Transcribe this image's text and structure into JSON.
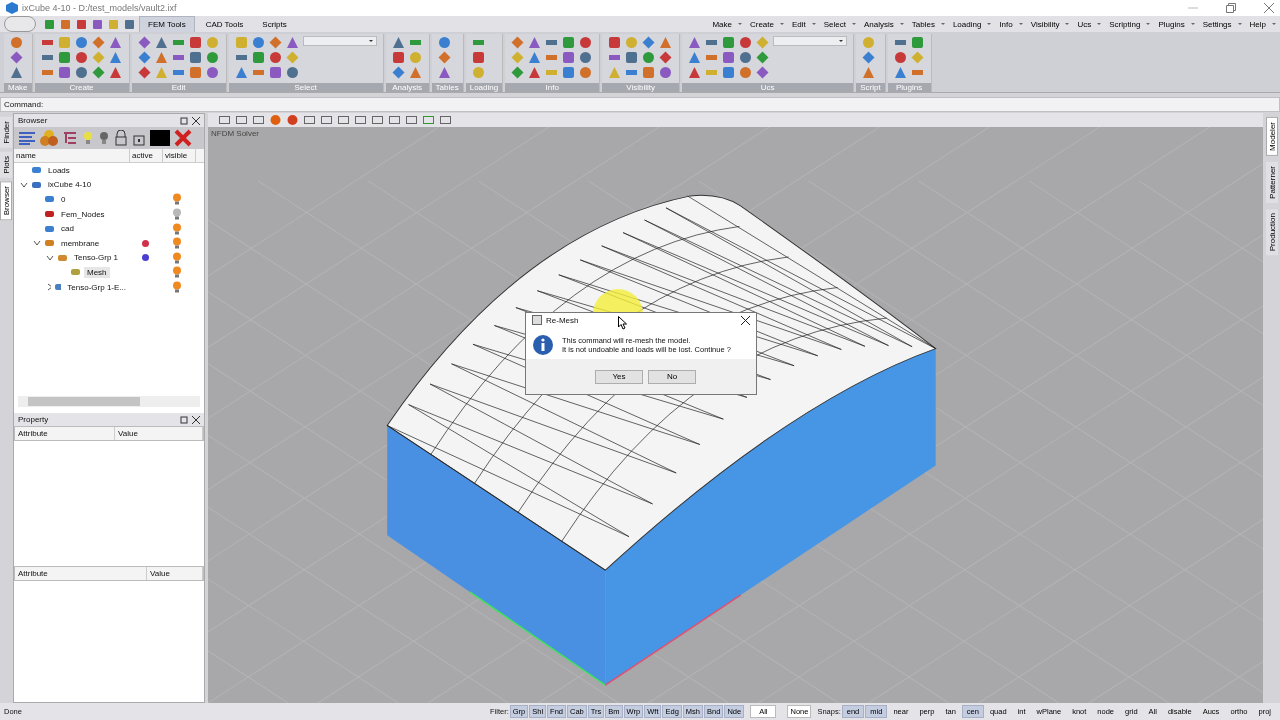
{
  "window": {
    "title": "ixCube 4-10 - D:/test_models/vault2.ixf"
  },
  "ribbon_tabs": [
    {
      "label": "FEM Tools",
      "selected": true
    },
    {
      "label": "CAD Tools",
      "selected": false
    },
    {
      "label": "Scripts",
      "selected": false
    }
  ],
  "menus": [
    "Make",
    "Create",
    "Edit",
    "Select",
    "Analysis",
    "Tables",
    "Loading",
    "Info",
    "Visibility",
    "Ucs",
    "Scripting",
    "Plugins",
    "Settings",
    "Help"
  ],
  "ribbon_groups": [
    "Make",
    "Create",
    "Edit",
    "Select",
    "Analysis",
    "Tables",
    "Loading",
    "Info",
    "Visibility",
    "Ucs",
    "Script",
    "Plugins"
  ],
  "command_bar": {
    "label": "Command:"
  },
  "side_tabs": [
    {
      "label": "Finder",
      "selected": false
    },
    {
      "label": "Plots",
      "selected": false
    },
    {
      "label": "Browser",
      "selected": true
    }
  ],
  "browser": {
    "title": "Browser",
    "columns": [
      "name",
      "active",
      "visible"
    ],
    "tree": [
      {
        "label": "Loads",
        "kind": "loads",
        "selected": false
      },
      {
        "label": "ixCube 4-10",
        "kind": "model",
        "selected": false,
        "expanded": true,
        "children": [
          {
            "label": "0",
            "kind": "layer",
            "selected": false,
            "visible": true
          },
          {
            "label": "Fem_Nodes",
            "kind": "nodes",
            "selected": false,
            "visible": false
          },
          {
            "label": "cad",
            "kind": "layer",
            "selected": false,
            "visible": true
          },
          {
            "label": "membrane",
            "kind": "group",
            "selected": false,
            "visible": true,
            "color": "#d0304a",
            "expanded": true,
            "children": [
              {
                "label": "Tenso-Grp 1",
                "kind": "tenso",
                "selected": false,
                "visible": true,
                "color": "#4a3fd0",
                "expanded": true,
                "children": [
                  {
                    "label": "Mesh",
                    "kind": "mesh",
                    "selected": true,
                    "visible": true
                  }
                ]
              },
              {
                "label": "Tenso-Grp 1-E...",
                "kind": "edge",
                "selected": false,
                "visible": true,
                "expanded": false
              }
            ]
          }
        ]
      }
    ]
  },
  "property": {
    "title": "Property",
    "columns": [
      "Attribute",
      "Value"
    ],
    "columns_lower": [
      "Attribute",
      "Value"
    ]
  },
  "viewport": {
    "label": "NFDM Solver"
  },
  "right_tabs": [
    {
      "label": "Modeler",
      "selected": true
    },
    {
      "label": "Patterner",
      "selected": false
    },
    {
      "label": "Production",
      "selected": false
    }
  ],
  "dialog": {
    "title": "Re-Mesh",
    "lines": [
      "This command will re-mesh the model.",
      "It is not undoable and loads will be lost. Continue ?"
    ],
    "buttons": [
      "Yes",
      "No"
    ]
  },
  "status_bar": {
    "message": "Done",
    "filter_label": "Filter:",
    "filters": [
      {
        "label": "Grp",
        "selected": true
      },
      {
        "label": "Shl",
        "selected": true
      },
      {
        "label": "Fnd",
        "selected": true
      },
      {
        "label": "Cab",
        "selected": true
      },
      {
        "label": "Trs",
        "selected": true
      },
      {
        "label": "Bm",
        "selected": true
      },
      {
        "label": "Wrp",
        "selected": true
      },
      {
        "label": "Wft",
        "selected": true
      },
      {
        "label": "Edg",
        "selected": true
      },
      {
        "label": "Msh",
        "selected": true
      },
      {
        "label": "Bnd",
        "selected": true
      },
      {
        "label": "Nde",
        "selected": true
      }
    ],
    "filter_all": "All",
    "snaps_none": "None",
    "snaps_label": "Snaps:",
    "snaps": [
      {
        "label": "end",
        "selected": true
      },
      {
        "label": "mid",
        "selected": true
      },
      {
        "label": "near",
        "selected": false
      },
      {
        "label": "perp",
        "selected": false
      },
      {
        "label": "tan",
        "selected": false
      },
      {
        "label": "cen",
        "selected": true
      },
      {
        "label": "quad",
        "selected": false
      },
      {
        "label": "int",
        "selected": false
      },
      {
        "label": "wPlane",
        "selected": false
      },
      {
        "label": "knot",
        "selected": false
      },
      {
        "label": "node",
        "selected": false
      },
      {
        "label": "grid",
        "selected": false
      },
      {
        "label": "All",
        "selected": false
      },
      {
        "label": "disable",
        "selected": false
      },
      {
        "label": "Aucs",
        "selected": false
      },
      {
        "label": "ortho",
        "selected": false
      },
      {
        "label": "proj",
        "selected": false
      }
    ]
  }
}
